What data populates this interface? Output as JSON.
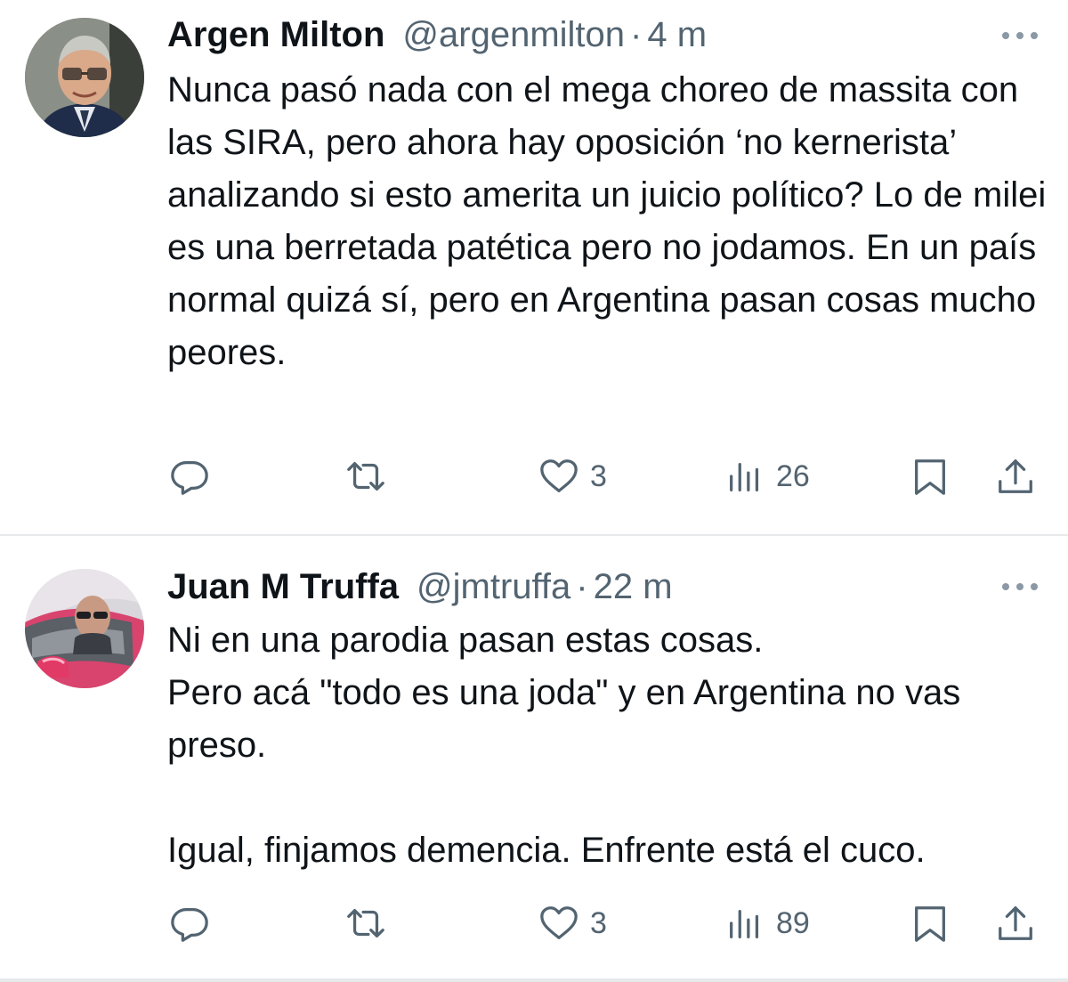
{
  "tweets": [
    {
      "display_name": "Argen Milton",
      "handle": "@argenmilton",
      "separator": "·",
      "time": "4 m",
      "text": "Nunca pasó nada con el mega choreo de massita con las SIRA, pero ahora hay oposición ‘no kernerista’ analizando si esto amerita un juicio político? Lo de milei es una berretada patética pero no jodamos. En un país normal quizá sí, pero en Argentina pasan cosas mucho peores.",
      "likes": "3",
      "views": "26"
    },
    {
      "display_name": "Juan M Truffa",
      "handle": "@jmtruffa",
      "separator": "·",
      "time": "22 m",
      "text": "Ni en una parodia pasan estas cosas.\nPero acá \"todo es una joda\" y en Argentina no vas preso.\n\nIgual, finjamos demencia. Enfrente está el cuco.",
      "likes": "3",
      "views": "89"
    }
  ],
  "icons": {
    "reply": "reply-icon",
    "retweet": "retweet-icon",
    "like": "heart-icon",
    "views": "views-icon",
    "bookmark": "bookmark-icon",
    "share": "share-icon",
    "more": "more-icon"
  },
  "colors": {
    "text": "#0f1419",
    "secondary": "#536471",
    "divider": "#e7e9ea"
  }
}
